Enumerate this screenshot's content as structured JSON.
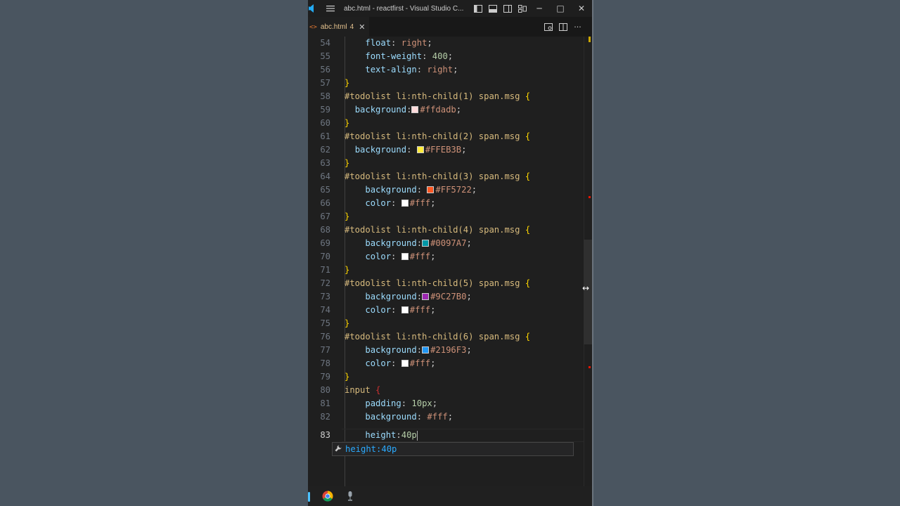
{
  "window": {
    "title": "abc.html - reactfirst - Visual Studio C...",
    "min_label": "─",
    "max_label": "□",
    "close_label": "✕"
  },
  "tab": {
    "name": "abc.html",
    "badge": "4",
    "close": "✕",
    "icon": "<>"
  },
  "suggestion": {
    "label": "height:40p",
    "icon": "wrench-icon"
  },
  "colors": {
    "swatch_ffdadb": "#ffdadb",
    "swatch_FFEB3B": "#FFEB3B",
    "swatch_FF5722": "#FF5722",
    "swatch_fff": "#ffffff",
    "swatch_0097A7": "#0097A7",
    "swatch_9C27B0": "#9C27B0",
    "swatch_2196F3": "#2196F3"
  },
  "code": {
    "l54": {
      "n": "54",
      "prop": "float",
      "val": "right"
    },
    "l55": {
      "n": "55",
      "prop": "font-weight",
      "val": "400"
    },
    "l56": {
      "n": "56",
      "prop": "text-align",
      "val": "right"
    },
    "l57": {
      "n": "57"
    },
    "l58": {
      "n": "58",
      "sel": "#todolist li:nth-child(1) span.msg"
    },
    "l59": {
      "n": "59",
      "prop": "background",
      "val": "#ffdadb"
    },
    "l60": {
      "n": "60"
    },
    "l61": {
      "n": "61",
      "sel": "#todolist li:nth-child(2) span.msg"
    },
    "l62": {
      "n": "62",
      "prop": "background",
      "val": "#FFEB3B"
    },
    "l63": {
      "n": "63"
    },
    "l64": {
      "n": "64",
      "sel": "#todolist li:nth-child(3) span.msg"
    },
    "l65": {
      "n": "65",
      "prop": "background",
      "val": "#FF5722"
    },
    "l66": {
      "n": "66",
      "prop": "color",
      "val": "#fff"
    },
    "l67": {
      "n": "67"
    },
    "l68": {
      "n": "68",
      "sel": "#todolist li:nth-child(4) span.msg"
    },
    "l69": {
      "n": "69",
      "prop": "background",
      "val": "#0097A7"
    },
    "l70": {
      "n": "70",
      "prop": "color",
      "val": "#fff"
    },
    "l71": {
      "n": "71"
    },
    "l72": {
      "n": "72",
      "sel": "#todolist li:nth-child(5) span.msg"
    },
    "l73": {
      "n": "73",
      "prop": "background",
      "val": "#9C27B0"
    },
    "l74": {
      "n": "74",
      "prop": "color",
      "val": "#fff"
    },
    "l75": {
      "n": "75"
    },
    "l76": {
      "n": "76",
      "sel": "#todolist li:nth-child(6) span.msg"
    },
    "l77": {
      "n": "77",
      "prop": "background",
      "val": "#2196F3"
    },
    "l78": {
      "n": "78",
      "prop": "color",
      "val": "#fff"
    },
    "l79": {
      "n": "79"
    },
    "l80": {
      "n": "80",
      "sel": "input"
    },
    "l81": {
      "n": "81",
      "prop": "padding",
      "val": "10px"
    },
    "l82": {
      "n": "82",
      "prop": "background",
      "val": "#fff"
    },
    "l83": {
      "n": "83",
      "prop": "height",
      "val": "40p"
    }
  }
}
